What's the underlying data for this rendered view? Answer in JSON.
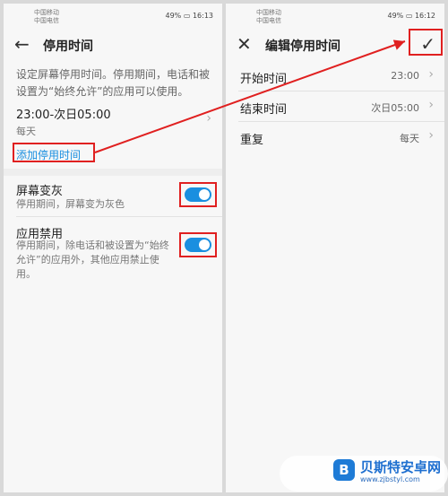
{
  "left": {
    "status": {
      "carrier1": "中国移动",
      "carrier2": "中国电信",
      "battery": "49%",
      "time": "16:13"
    },
    "title": "停用时间",
    "description": "设定屏幕停用时间。停用期间，电话和被设置为“始终允许”的应用可以使用。",
    "schedule": {
      "time_range": "23:00-次日05:00",
      "repeat": "每天"
    },
    "add_label": "添加停用时间",
    "grayscale": {
      "title": "屏幕变灰",
      "subtitle": "停用期间，屏幕变为灰色",
      "enabled": true
    },
    "app_block": {
      "title": "应用禁用",
      "subtitle": "停用期间，除电话和被设置为“始终允许”的应用外，其他应用禁止使用。",
      "enabled": true
    }
  },
  "right": {
    "status": {
      "carrier1": "中国移动",
      "carrier2": "中国电信",
      "battery": "49%",
      "time": "16:12"
    },
    "title": "编辑停用时间",
    "rows": [
      {
        "label": "开始时间",
        "value": "23:00"
      },
      {
        "label": "结束时间",
        "value": "次日05:00"
      },
      {
        "label": "重复",
        "value": "每天"
      }
    ]
  },
  "watermark": {
    "name": "贝斯特安卓网",
    "url": "www.zjbstyl.com"
  },
  "colors": {
    "accent": "#1a8fe0",
    "annotation": "#e02020"
  }
}
